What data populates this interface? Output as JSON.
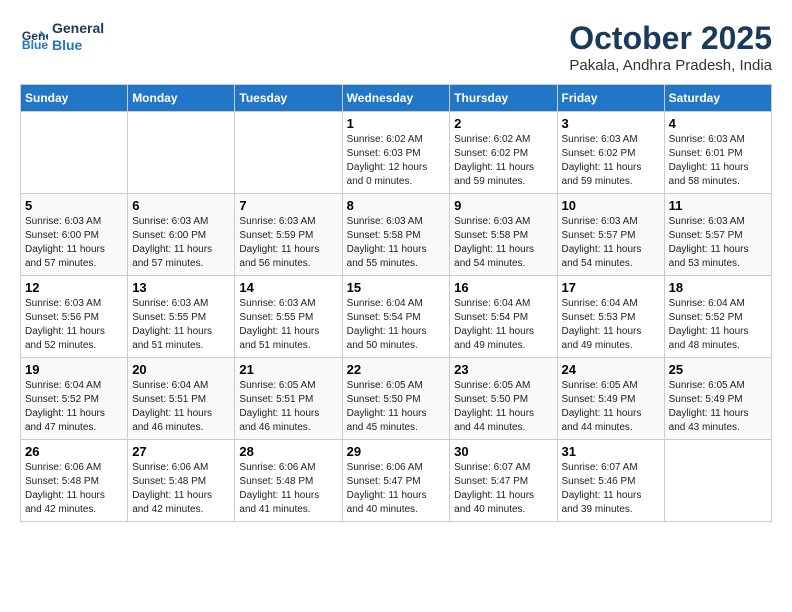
{
  "header": {
    "logo_line1": "General",
    "logo_line2": "Blue",
    "month": "October 2025",
    "location": "Pakala, Andhra Pradesh, India"
  },
  "weekdays": [
    "Sunday",
    "Monday",
    "Tuesday",
    "Wednesday",
    "Thursday",
    "Friday",
    "Saturday"
  ],
  "weeks": [
    [
      {
        "day": "",
        "info": ""
      },
      {
        "day": "",
        "info": ""
      },
      {
        "day": "",
        "info": ""
      },
      {
        "day": "1",
        "info": "Sunrise: 6:02 AM\nSunset: 6:03 PM\nDaylight: 12 hours\nand 0 minutes."
      },
      {
        "day": "2",
        "info": "Sunrise: 6:02 AM\nSunset: 6:02 PM\nDaylight: 11 hours\nand 59 minutes."
      },
      {
        "day": "3",
        "info": "Sunrise: 6:03 AM\nSunset: 6:02 PM\nDaylight: 11 hours\nand 59 minutes."
      },
      {
        "day": "4",
        "info": "Sunrise: 6:03 AM\nSunset: 6:01 PM\nDaylight: 11 hours\nand 58 minutes."
      }
    ],
    [
      {
        "day": "5",
        "info": "Sunrise: 6:03 AM\nSunset: 6:00 PM\nDaylight: 11 hours\nand 57 minutes."
      },
      {
        "day": "6",
        "info": "Sunrise: 6:03 AM\nSunset: 6:00 PM\nDaylight: 11 hours\nand 57 minutes."
      },
      {
        "day": "7",
        "info": "Sunrise: 6:03 AM\nSunset: 5:59 PM\nDaylight: 11 hours\nand 56 minutes."
      },
      {
        "day": "8",
        "info": "Sunrise: 6:03 AM\nSunset: 5:58 PM\nDaylight: 11 hours\nand 55 minutes."
      },
      {
        "day": "9",
        "info": "Sunrise: 6:03 AM\nSunset: 5:58 PM\nDaylight: 11 hours\nand 54 minutes."
      },
      {
        "day": "10",
        "info": "Sunrise: 6:03 AM\nSunset: 5:57 PM\nDaylight: 11 hours\nand 54 minutes."
      },
      {
        "day": "11",
        "info": "Sunrise: 6:03 AM\nSunset: 5:57 PM\nDaylight: 11 hours\nand 53 minutes."
      }
    ],
    [
      {
        "day": "12",
        "info": "Sunrise: 6:03 AM\nSunset: 5:56 PM\nDaylight: 11 hours\nand 52 minutes."
      },
      {
        "day": "13",
        "info": "Sunrise: 6:03 AM\nSunset: 5:55 PM\nDaylight: 11 hours\nand 51 minutes."
      },
      {
        "day": "14",
        "info": "Sunrise: 6:03 AM\nSunset: 5:55 PM\nDaylight: 11 hours\nand 51 minutes."
      },
      {
        "day": "15",
        "info": "Sunrise: 6:04 AM\nSunset: 5:54 PM\nDaylight: 11 hours\nand 50 minutes."
      },
      {
        "day": "16",
        "info": "Sunrise: 6:04 AM\nSunset: 5:54 PM\nDaylight: 11 hours\nand 49 minutes."
      },
      {
        "day": "17",
        "info": "Sunrise: 6:04 AM\nSunset: 5:53 PM\nDaylight: 11 hours\nand 49 minutes."
      },
      {
        "day": "18",
        "info": "Sunrise: 6:04 AM\nSunset: 5:52 PM\nDaylight: 11 hours\nand 48 minutes."
      }
    ],
    [
      {
        "day": "19",
        "info": "Sunrise: 6:04 AM\nSunset: 5:52 PM\nDaylight: 11 hours\nand 47 minutes."
      },
      {
        "day": "20",
        "info": "Sunrise: 6:04 AM\nSunset: 5:51 PM\nDaylight: 11 hours\nand 46 minutes."
      },
      {
        "day": "21",
        "info": "Sunrise: 6:05 AM\nSunset: 5:51 PM\nDaylight: 11 hours\nand 46 minutes."
      },
      {
        "day": "22",
        "info": "Sunrise: 6:05 AM\nSunset: 5:50 PM\nDaylight: 11 hours\nand 45 minutes."
      },
      {
        "day": "23",
        "info": "Sunrise: 6:05 AM\nSunset: 5:50 PM\nDaylight: 11 hours\nand 44 minutes."
      },
      {
        "day": "24",
        "info": "Sunrise: 6:05 AM\nSunset: 5:49 PM\nDaylight: 11 hours\nand 44 minutes."
      },
      {
        "day": "25",
        "info": "Sunrise: 6:05 AM\nSunset: 5:49 PM\nDaylight: 11 hours\nand 43 minutes."
      }
    ],
    [
      {
        "day": "26",
        "info": "Sunrise: 6:06 AM\nSunset: 5:48 PM\nDaylight: 11 hours\nand 42 minutes."
      },
      {
        "day": "27",
        "info": "Sunrise: 6:06 AM\nSunset: 5:48 PM\nDaylight: 11 hours\nand 42 minutes."
      },
      {
        "day": "28",
        "info": "Sunrise: 6:06 AM\nSunset: 5:48 PM\nDaylight: 11 hours\nand 41 minutes."
      },
      {
        "day": "29",
        "info": "Sunrise: 6:06 AM\nSunset: 5:47 PM\nDaylight: 11 hours\nand 40 minutes."
      },
      {
        "day": "30",
        "info": "Sunrise: 6:07 AM\nSunset: 5:47 PM\nDaylight: 11 hours\nand 40 minutes."
      },
      {
        "day": "31",
        "info": "Sunrise: 6:07 AM\nSunset: 5:46 PM\nDaylight: 11 hours\nand 39 minutes."
      },
      {
        "day": "",
        "info": ""
      }
    ]
  ]
}
